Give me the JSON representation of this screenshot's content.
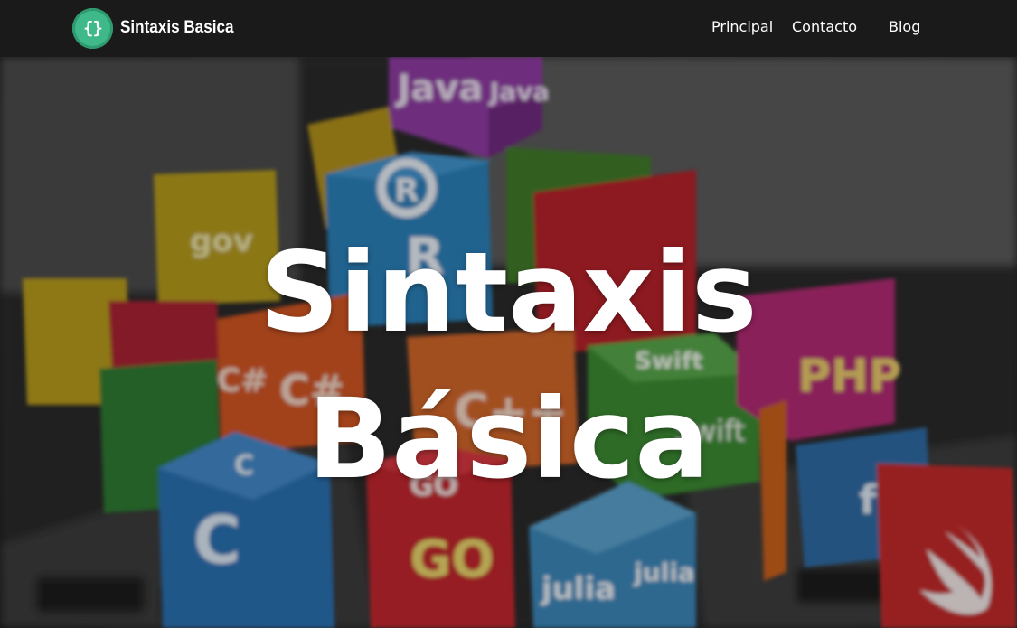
{
  "brand": {
    "logo_glyph": "{}",
    "name": "Sintaxis Basica"
  },
  "nav": {
    "items": [
      {
        "label": "Principal"
      },
      {
        "label": "Contacto"
      },
      {
        "label": "Blog"
      }
    ]
  },
  "hero": {
    "title_line1": "Sintaxis",
    "title_line2": "Básica",
    "background": {
      "subject": "programming-language-cubes-on-keyboard",
      "cube_labels": [
        "Java",
        "Java",
        "R",
        "R",
        "gov",
        "C#",
        "C#",
        "C++",
        "Swift",
        "Swift",
        "PHP",
        "GO",
        "GO",
        "C",
        "C",
        "julia",
        "julia",
        "f"
      ]
    }
  },
  "colors": {
    "navbar_bg": "#1a1a1a",
    "logo_green": "#3fb98a",
    "text_white": "#ffffff"
  }
}
